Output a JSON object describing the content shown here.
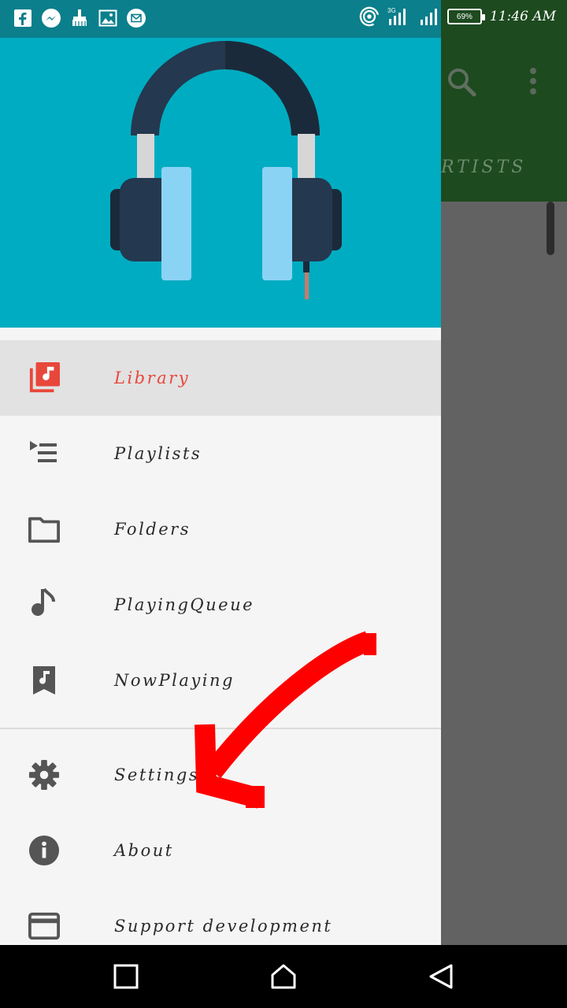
{
  "status_bar": {
    "battery_label": "69%",
    "time": "11:46 AM",
    "icons_left": [
      "facebook-icon",
      "messenger-icon",
      "cleaner-icon",
      "gallery-icon",
      "email-icon"
    ],
    "icons_right": [
      "hotspot-icon",
      "signal-3g-icon",
      "signal-icon",
      "battery-icon"
    ]
  },
  "app": {
    "tab_partial": "RTISTS",
    "toolbar_color": "#1d4a1f"
  },
  "drawer": {
    "header_color": "#00acc1",
    "items": [
      {
        "label": "Library",
        "icon": "library-music-icon",
        "selected": true
      },
      {
        "label": "Playlists",
        "icon": "playlist-icon",
        "selected": false
      },
      {
        "label": "Folders",
        "icon": "folder-icon",
        "selected": false
      },
      {
        "label": "PlayingQueue",
        "icon": "music-note-icon",
        "selected": false
      },
      {
        "label": "NowPlaying",
        "icon": "now-playing-icon",
        "selected": false
      }
    ],
    "secondary_items": [
      {
        "label": "Settings",
        "icon": "gear-icon"
      },
      {
        "label": "About",
        "icon": "info-icon"
      },
      {
        "label": "Support development",
        "icon": "credit-card-icon"
      }
    ]
  },
  "colors": {
    "accent": "#e8473b",
    "annotation": "#ff0000"
  }
}
